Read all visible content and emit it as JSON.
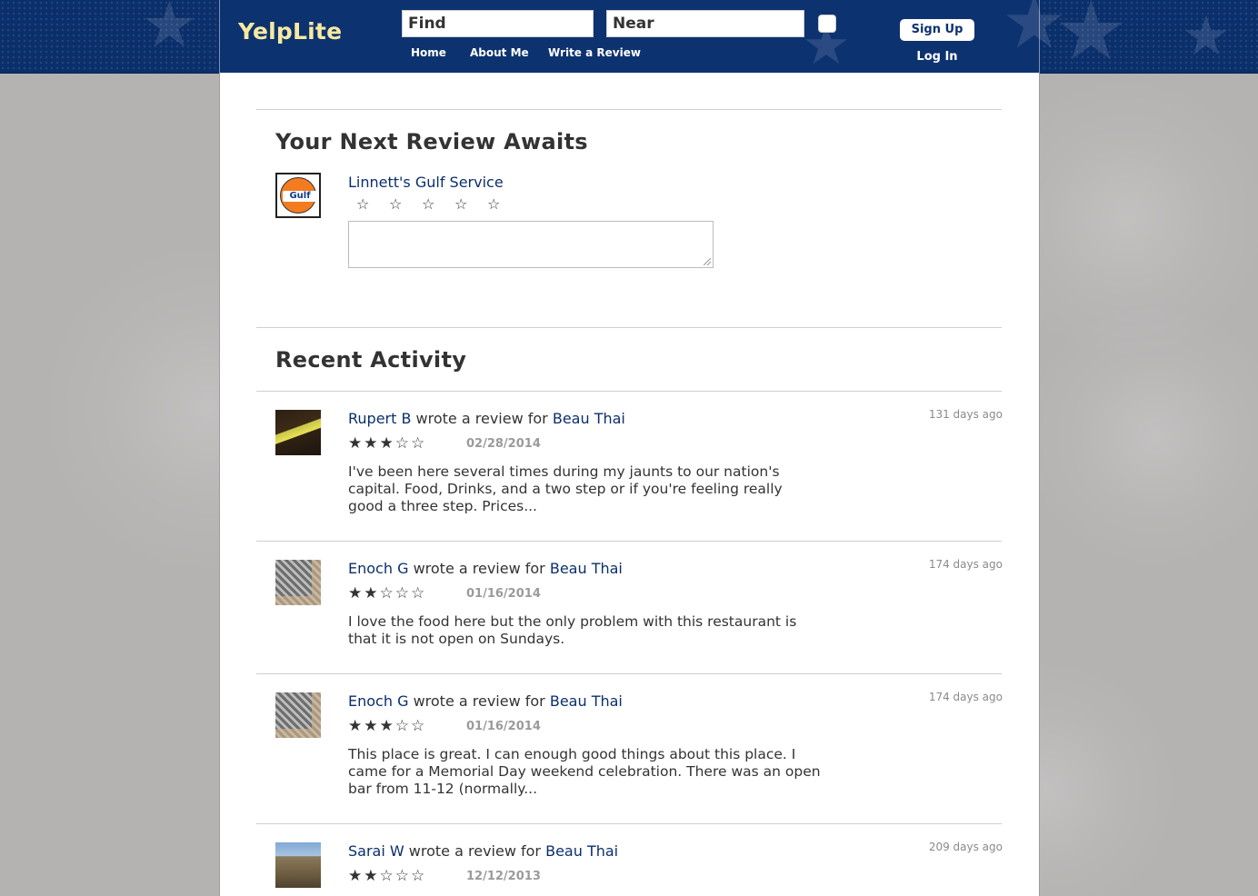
{
  "header": {
    "logo": "YelpLite",
    "search_find_placeholder": "Find",
    "search_near_placeholder": "Near",
    "nav": [
      "Home",
      "About Me",
      "Write a Review"
    ],
    "signup_label": "Sign Up",
    "login_label": "Log In"
  },
  "next_review": {
    "heading": "Your Next Review Awaits",
    "business_name": "Linnett's Gulf Service",
    "logo_text": "Gulf",
    "rating_stars": [
      "☆",
      "☆",
      "☆",
      "☆",
      "☆"
    ]
  },
  "recent_activity": {
    "heading": "Recent Activity",
    "items": [
      {
        "user": "Rupert B",
        "action": "wrote a review for",
        "business": "Beau Thai",
        "ago": "131 days ago",
        "stars": "★★★☆☆",
        "rating": 3,
        "date": "02/28/2014",
        "excerpt": "I've been here several times during my jaunts to our nation's capital. Food, Drinks, and a two step or if you're feeling really good a three step. Prices..."
      },
      {
        "user": "Enoch G",
        "action": "wrote a review for",
        "business": "Beau Thai",
        "ago": "174 days ago",
        "stars": "★★☆☆☆",
        "rating": 2,
        "date": "01/16/2014",
        "excerpt": "I love the food here but the only problem with this restaurant is that it is not open on Sundays."
      },
      {
        "user": "Enoch G",
        "action": "wrote a review for",
        "business": "Beau Thai",
        "ago": "174 days ago",
        "stars": "★★★☆☆",
        "rating": 3,
        "date": "01/16/2014",
        "excerpt": "This place is great. I can enough good things about this place. I came for a Memorial Day weekend celebration. There was an open bar from 11-12 (normally..."
      },
      {
        "user": "Sarai W",
        "action": "wrote a review for",
        "business": "Beau Thai",
        "ago": "209 days ago",
        "stars": "★★☆☆☆",
        "rating": 2,
        "date": "12/12/2013",
        "excerpt": ""
      }
    ]
  },
  "colors": {
    "header_bg": "#0d3270",
    "logo": "#f7e9a0",
    "link": "#0b2f6b",
    "page_bg": "#b5b2b2"
  }
}
